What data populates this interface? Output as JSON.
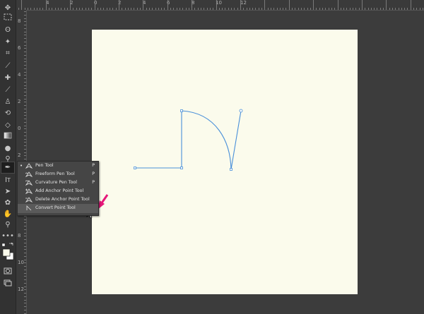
{
  "rulers": {
    "top_numbers": [
      "4",
      "2",
      "0",
      "2",
      "4",
      "6",
      "8",
      "10",
      "12"
    ],
    "left_numbers": [
      "8",
      "6",
      "4",
      "2",
      "0",
      "2",
      "4",
      "6",
      "8",
      "10",
      "12"
    ]
  },
  "flyout": {
    "items": [
      {
        "label": "Pen Tool",
        "shortcut": "P",
        "icon": "pen-icon",
        "active": true
      },
      {
        "label": "Freeform Pen Tool",
        "shortcut": "P",
        "icon": "freeform-pen-icon",
        "active": false
      },
      {
        "label": "Curvature Pen Tool",
        "shortcut": "P",
        "icon": "curvature-pen-icon",
        "active": false
      },
      {
        "label": "Add Anchor Point Tool",
        "shortcut": "",
        "icon": "add-anchor-icon",
        "active": false
      },
      {
        "label": "Delete Anchor Point Tool",
        "shortcut": "",
        "icon": "delete-anchor-icon",
        "active": false
      },
      {
        "label": "Convert Point Tool",
        "shortcut": "",
        "icon": "convert-point-icon",
        "active": false
      }
    ]
  },
  "colors": {
    "canvas_background": "#fbfbec",
    "path_stroke": "#4a90d9",
    "annotation_arrow": "#e6177a"
  },
  "tools": [
    "move-icon",
    "marquee-icon",
    "lasso-icon",
    "magic-wand-icon",
    "crop-icon",
    "eyedropper-icon",
    "healing-icon",
    "brush-icon",
    "clone-stamp-icon",
    "history-brush-icon",
    "eraser-icon",
    "gradient-icon",
    "blur-icon",
    "dodge-icon",
    "pen-icon",
    "type-icon",
    "path-selection-icon",
    "shape-icon",
    "hand-icon",
    "zoom-icon",
    "more-icon",
    "color-swatch-icon",
    "quick-mask-icon",
    "screen-mode-icon"
  ]
}
